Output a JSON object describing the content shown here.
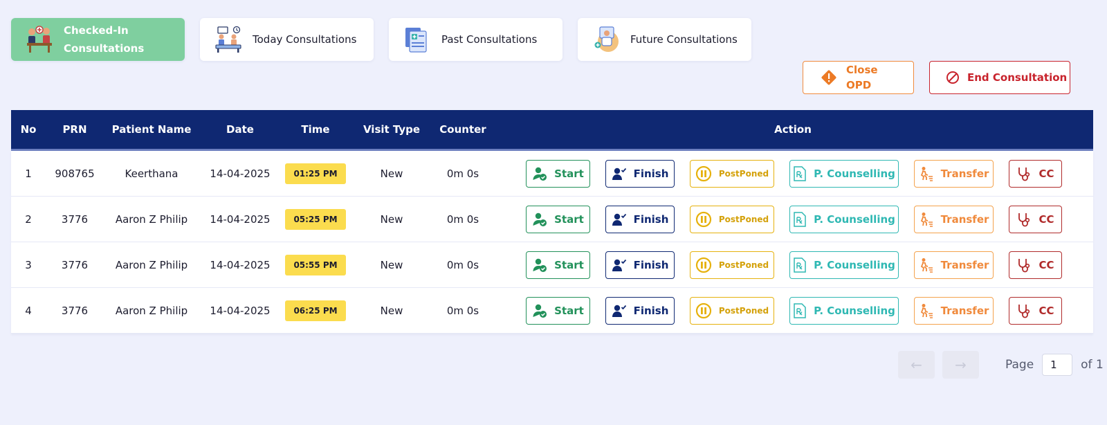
{
  "tabs": [
    {
      "label": "Checked-In\nConsultations",
      "active": true,
      "icon": "checked-in-icon"
    },
    {
      "label": "Today Consultations",
      "active": false,
      "icon": "waiting-room-icon"
    },
    {
      "label": "Past Consultations",
      "active": false,
      "icon": "medical-records-icon"
    },
    {
      "label": "Future Consultations",
      "active": false,
      "icon": "doctor-icon"
    }
  ],
  "header_buttons": {
    "close_opd": "Close\nOPD",
    "end_consultation": "End Consultation"
  },
  "columns": [
    "No",
    "PRN",
    "Patient Name",
    "Date",
    "Time",
    "Visit Type",
    "Counter",
    "Action"
  ],
  "actions": {
    "start": "Start",
    "finish": "Finish",
    "postponed": "PostPoned",
    "p_counselling": "P. Counselling",
    "transfer": "Transfer",
    "cc": "CC"
  },
  "rows": [
    {
      "no": "1",
      "prn": "908765",
      "name": "Keerthana",
      "date": "14-04-2025",
      "time": "01:25 PM",
      "visit_type": "New",
      "counter": "0m 0s"
    },
    {
      "no": "2",
      "prn": "3776",
      "name": "Aaron Z Philip",
      "date": "14-04-2025",
      "time": "05:25 PM",
      "visit_type": "New",
      "counter": "0m 0s"
    },
    {
      "no": "3",
      "prn": "3776",
      "name": "Aaron Z Philip",
      "date": "14-04-2025",
      "time": "05:55 PM",
      "visit_type": "New",
      "counter": "0m 0s"
    },
    {
      "no": "4",
      "prn": "3776",
      "name": "Aaron Z Philip",
      "date": "14-04-2025",
      "time": "06:25 PM",
      "visit_type": "New",
      "counter": "0m 0s"
    }
  ],
  "pagination": {
    "prev": "←",
    "next": "→",
    "page_label": "Page",
    "current_page": "1",
    "of_label": "of 1"
  },
  "colors": {
    "header_bg": "#0f2872",
    "active_tab": "#7fcf9f",
    "time_badge": "#fbdc4e",
    "start": "#22915a",
    "finish": "#0f2872",
    "postponed": "#e6b10c",
    "counselling": "#2fb8b3",
    "transfer": "#f08a3c",
    "cc": "#b02a2a",
    "end_consultation": "#c8232c"
  }
}
